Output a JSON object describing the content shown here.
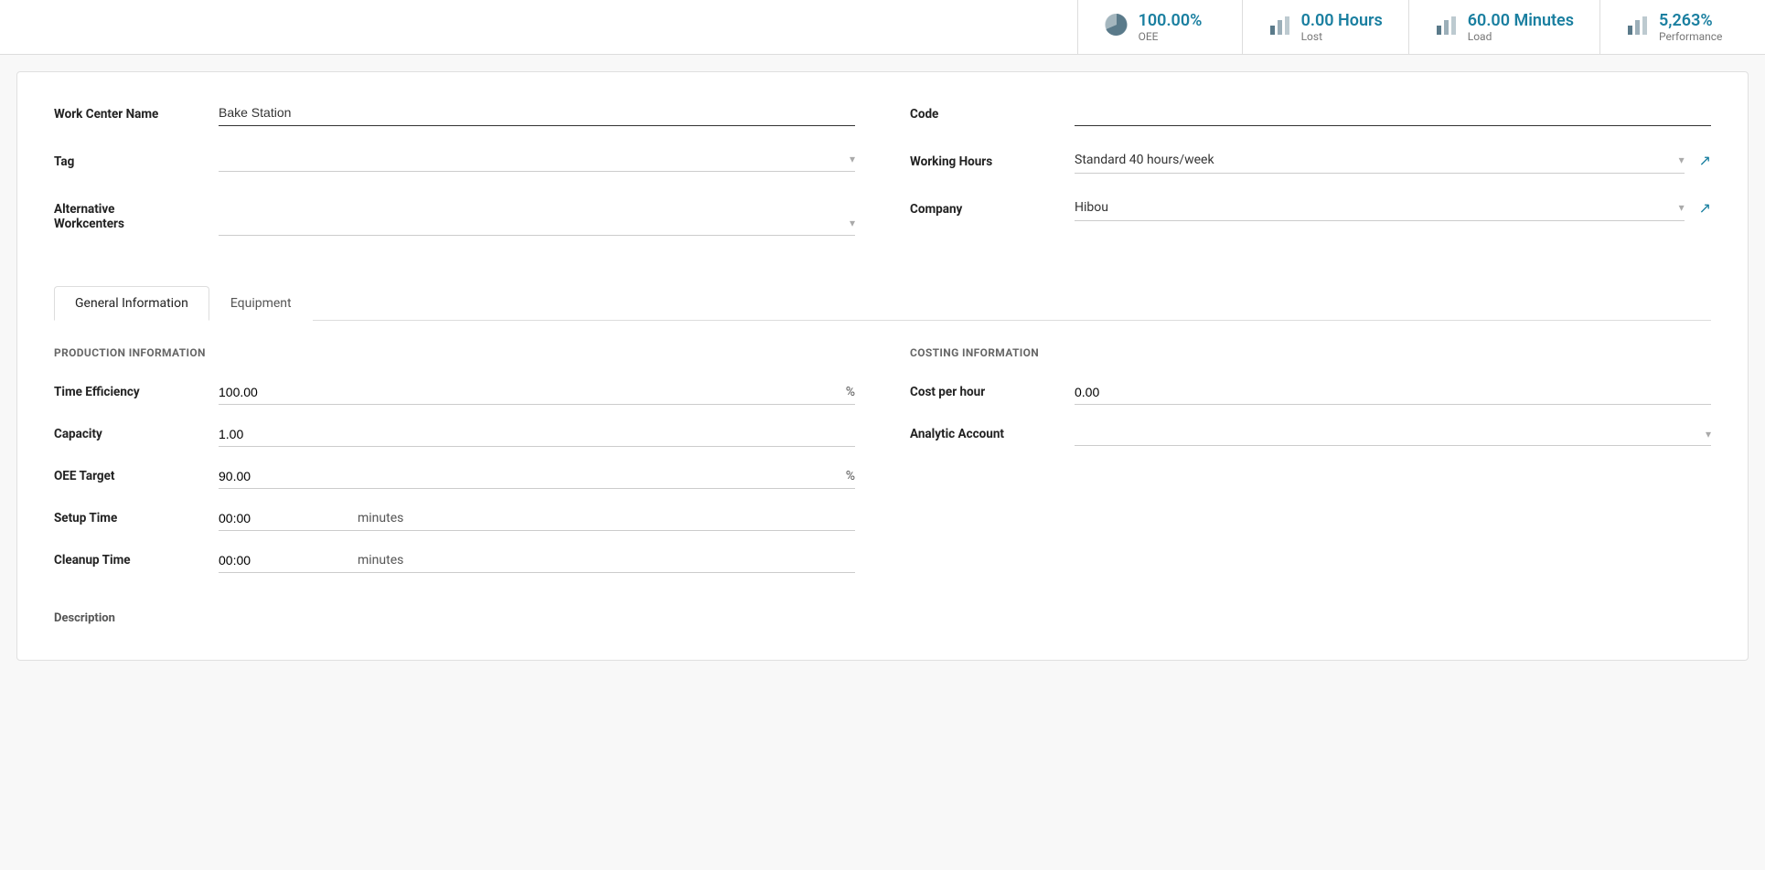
{
  "statsBar": {
    "spacer": "",
    "stats": [
      {
        "id": "oee",
        "value": "100.00%",
        "label": "OEE",
        "iconType": "pie"
      },
      {
        "id": "lost",
        "value": "0.00 Hours",
        "label": "Lost",
        "iconType": "bar"
      },
      {
        "id": "load",
        "value": "60.00 Minutes",
        "label": "Load",
        "iconType": "bar"
      },
      {
        "id": "performance",
        "value": "5,263%",
        "label": "Performance",
        "iconType": "bar"
      }
    ]
  },
  "form": {
    "left": {
      "workCenterName": {
        "label": "Work Center Name",
        "value": "Bake Station"
      },
      "tag": {
        "label": "Tag",
        "value": ""
      },
      "alternativeWorkcenters": {
        "label": "Alternative Workcenters",
        "value": ""
      }
    },
    "right": {
      "code": {
        "label": "Code",
        "value": ""
      },
      "workingHours": {
        "label": "Working Hours",
        "value": "Standard 40 hours/week"
      },
      "company": {
        "label": "Company",
        "value": "Hibou"
      }
    }
  },
  "tabs": [
    {
      "id": "general",
      "label": "General Information",
      "active": true
    },
    {
      "id": "equipment",
      "label": "Equipment",
      "active": false
    }
  ],
  "sections": {
    "production": {
      "header": "Production Information",
      "fields": [
        {
          "id": "timeEfficiency",
          "label": "Time Efficiency",
          "value": "100.00",
          "unit": "%"
        },
        {
          "id": "capacity",
          "label": "Capacity",
          "value": "1.00",
          "unit": ""
        },
        {
          "id": "oeeTarget",
          "label": "OEE Target",
          "value": "90.00",
          "unit": "%"
        },
        {
          "id": "setupTime",
          "label": "Setup Time",
          "value": "00:00",
          "unit": "minutes"
        },
        {
          "id": "cleanupTime",
          "label": "Cleanup Time",
          "value": "00:00",
          "unit": "minutes"
        }
      ]
    },
    "costing": {
      "header": "Costing Information",
      "fields": [
        {
          "id": "costPerHour",
          "label": "Cost per hour",
          "value": "0.00",
          "unit": ""
        },
        {
          "id": "analyticAccount",
          "label": "Analytic Account",
          "value": "",
          "isSelect": true
        }
      ]
    }
  },
  "description": {
    "label": "Description"
  }
}
